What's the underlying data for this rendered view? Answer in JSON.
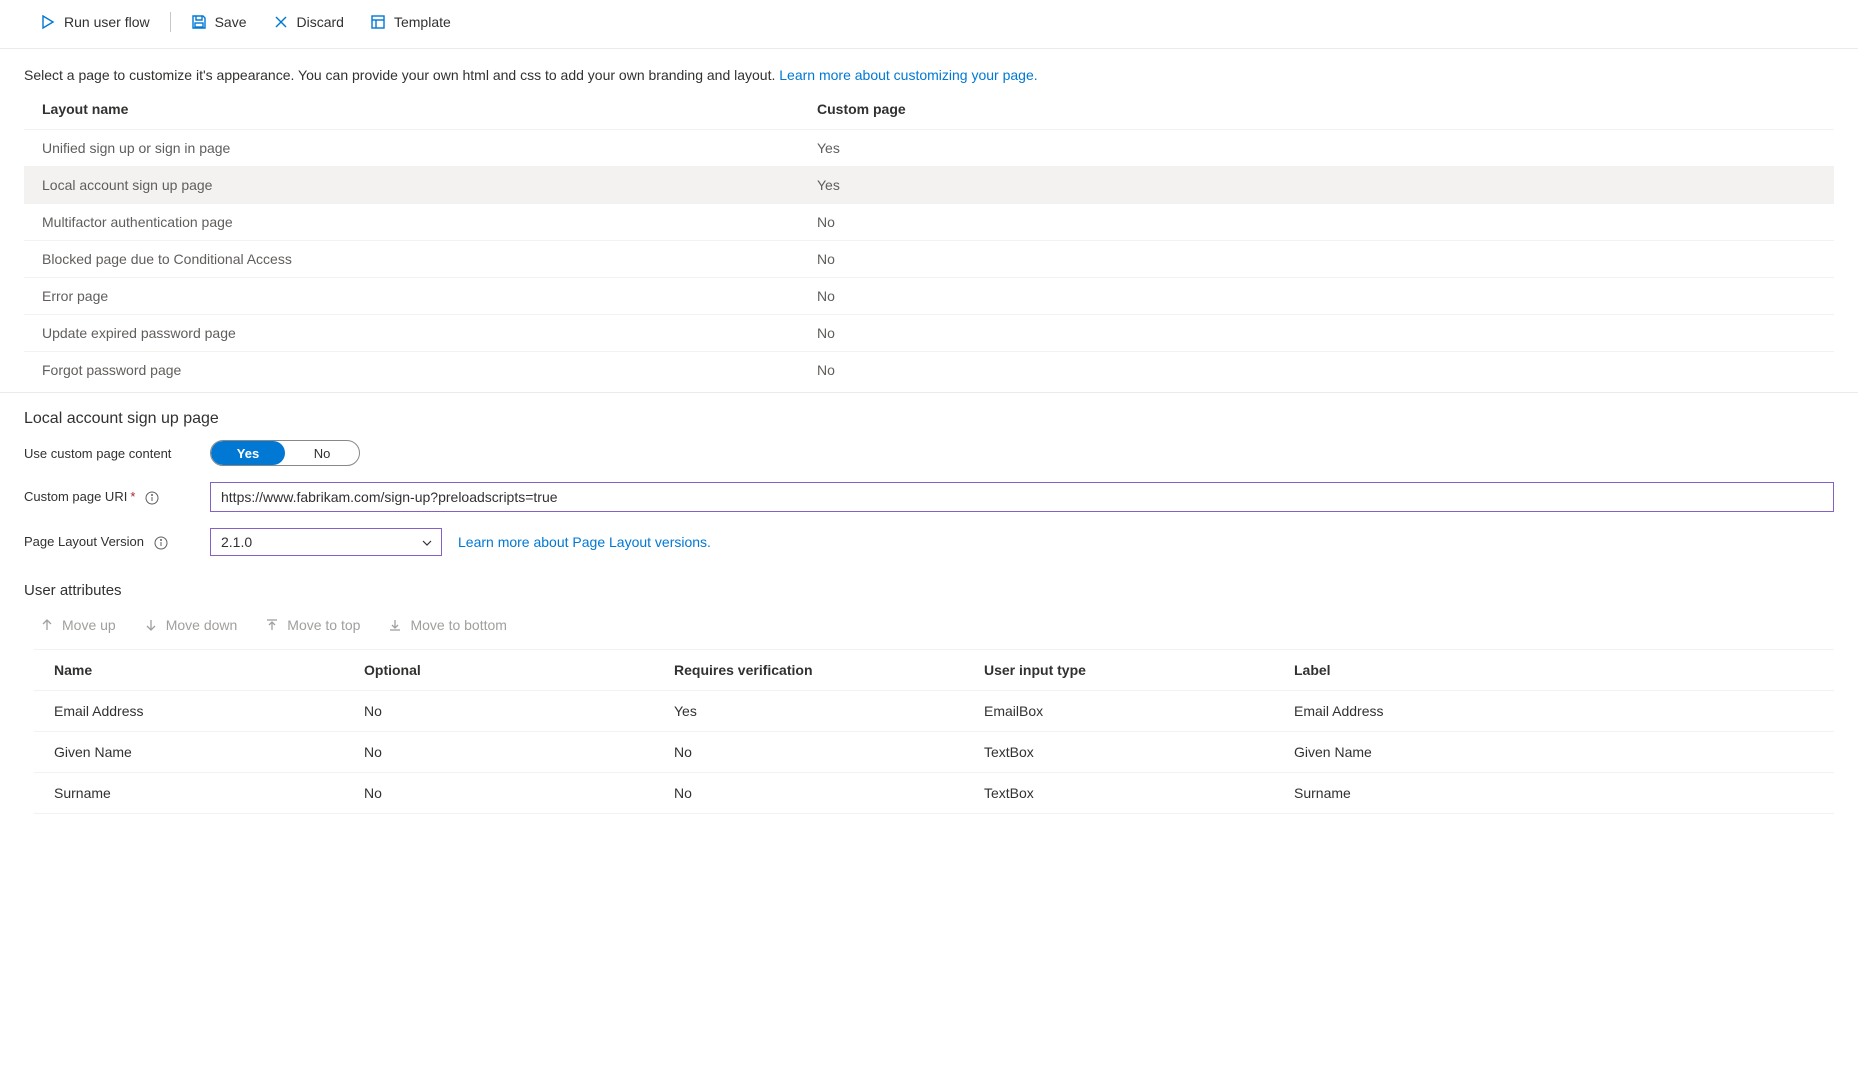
{
  "toolbar": {
    "run": "Run user flow",
    "save": "Save",
    "discard": "Discard",
    "template": "Template"
  },
  "intro": {
    "text": "Select a page to customize it's appearance. You can provide your own html and css to add your own branding and layout. ",
    "link": "Learn more about customizing your page."
  },
  "layouts": {
    "header_name": "Layout name",
    "header_custom": "Custom page",
    "rows": [
      {
        "name": "Unified sign up or sign in page",
        "custom": "Yes"
      },
      {
        "name": "Local account sign up page",
        "custom": "Yes"
      },
      {
        "name": "Multifactor authentication page",
        "custom": "No"
      },
      {
        "name": "Blocked page due to Conditional Access",
        "custom": "No"
      },
      {
        "name": "Error page",
        "custom": "No"
      },
      {
        "name": "Update expired password page",
        "custom": "No"
      },
      {
        "name": "Forgot password page",
        "custom": "No"
      }
    ],
    "selected_index": 1
  },
  "detail": {
    "title": "Local account sign up page",
    "use_custom_label": "Use custom page content",
    "toggle_yes": "Yes",
    "toggle_no": "No",
    "uri_label": "Custom page URI",
    "uri_value": "https://www.fabrikam.com/sign-up?preloadscripts=true",
    "version_label": "Page Layout Version",
    "version_value": "2.1.0",
    "version_link": "Learn more about Page Layout versions."
  },
  "ua": {
    "title": "User attributes",
    "move_up": "Move up",
    "move_down": "Move down",
    "move_top": "Move to top",
    "move_bottom": "Move to bottom",
    "cols": {
      "name": "Name",
      "optional": "Optional",
      "requires": "Requires verification",
      "input_type": "User input type",
      "label": "Label"
    },
    "rows": [
      {
        "name": "Email Address",
        "optional": "No",
        "requires": "Yes",
        "input": "EmailBox",
        "label": "Email Address"
      },
      {
        "name": "Given Name",
        "optional": "No",
        "requires": "No",
        "input": "TextBox",
        "label": "Given Name"
      },
      {
        "name": "Surname",
        "optional": "No",
        "requires": "No",
        "input": "TextBox",
        "label": "Surname"
      }
    ]
  }
}
